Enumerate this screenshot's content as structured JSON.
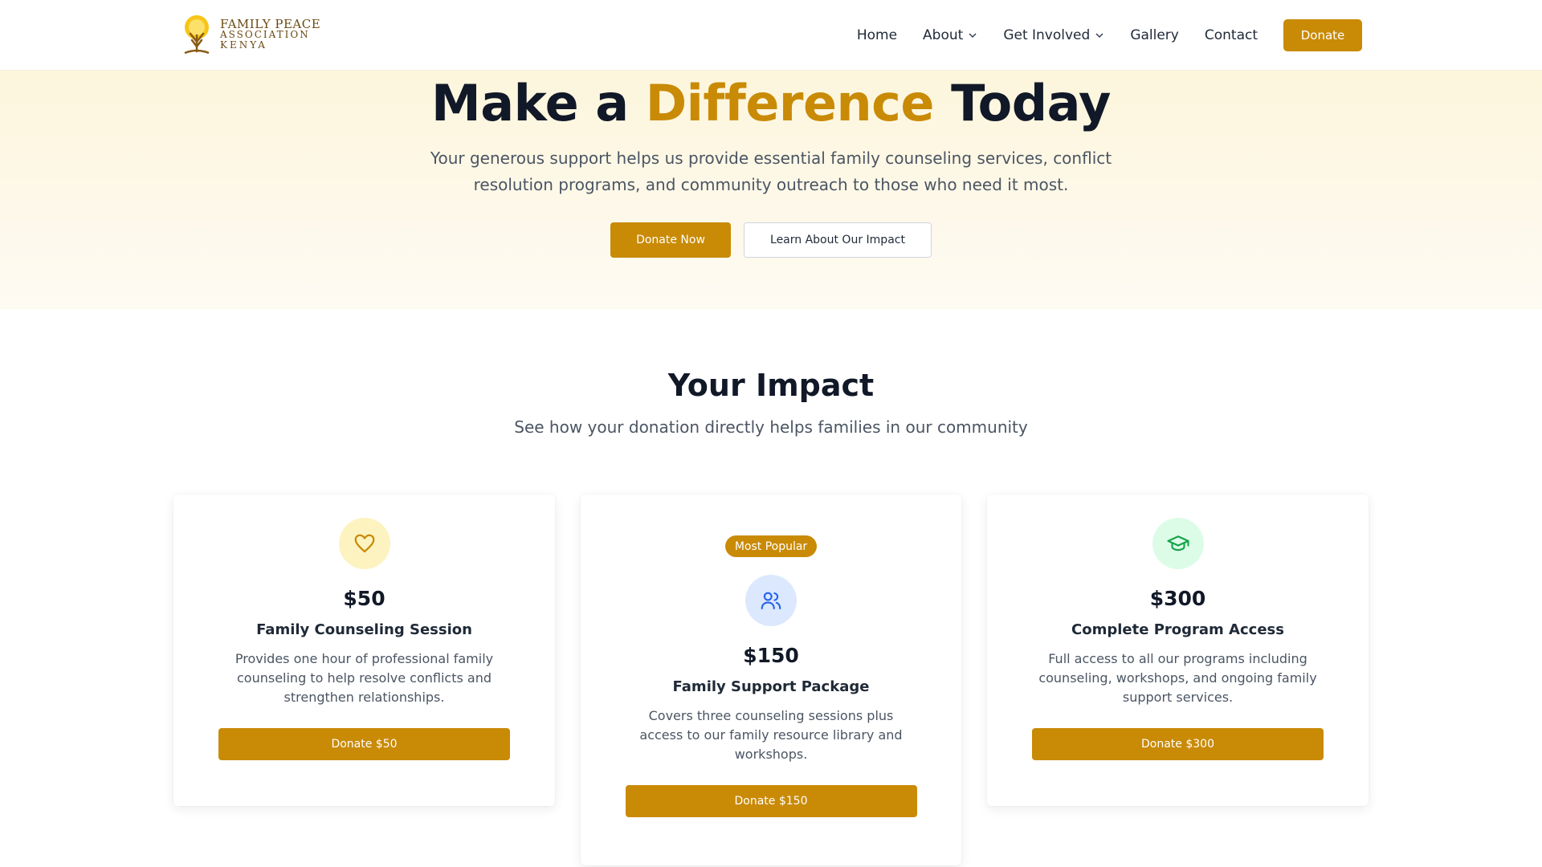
{
  "brand": {
    "line1": "FAMILY PEACE",
    "line2": "ASSOCIATION",
    "line3": "KENYA",
    "accent": "#c98a06"
  },
  "nav": {
    "home": "Home",
    "about": "About",
    "get_involved": "Get Involved",
    "gallery": "Gallery",
    "contact": "Contact",
    "donate": "Donate"
  },
  "hero": {
    "title_part1": "Make a ",
    "title_highlight": "Difference",
    "title_part2": " Today",
    "subtitle": "Your generous support helps us provide essential family counseling services, conflict resolution programs, and community outreach to those who need it most.",
    "primary_button": "Donate Now",
    "secondary_button": "Learn About Our Impact"
  },
  "impact": {
    "title": "Your Impact",
    "subtitle": "See how your donation directly helps families in our community",
    "cards": [
      {
        "icon": "heart-icon",
        "amount": "$50",
        "title": "Family Counseling Session",
        "description": "Provides one hour of professional family counseling to help resolve conflicts and strengthen relationships.",
        "button": "Donate $50"
      },
      {
        "badge": "Most Popular",
        "icon": "users-icon",
        "amount": "$150",
        "title": "Family Support Package",
        "description": "Covers three counseling sessions plus access to our family resource library and workshops.",
        "button": "Donate $150"
      },
      {
        "icon": "graduation-cap-icon",
        "amount": "$300",
        "title": "Complete Program Access",
        "description": "Full access to all our programs including counseling, workshops, and ongoing family support services.",
        "button": "Donate $300"
      }
    ]
  }
}
